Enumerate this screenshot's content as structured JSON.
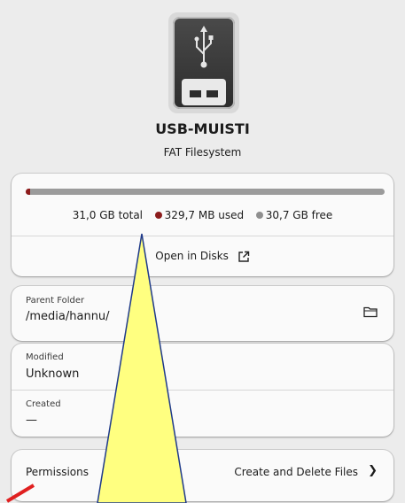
{
  "header": {
    "device_icon": "usb-drive-icon",
    "title": "USB-MUISTI",
    "subtitle": "FAT Filesystem"
  },
  "usage": {
    "total": "31,0 GB total",
    "used": "329,7 MB used",
    "free": "30,7 GB free",
    "used_fraction": 0.0106,
    "used_color": "#8e1b1b",
    "free_color": "#9b9b9b",
    "open_in_disks": "Open in Disks",
    "open_icon": "external-link-icon"
  },
  "parent": {
    "label": "Parent Folder",
    "value": "/media/hannu/",
    "icon": "folder-icon"
  },
  "dates": {
    "modified_label": "Modified",
    "modified_value": "Unknown",
    "created_label": "Created",
    "created_value": "—"
  },
  "permissions": {
    "label": "Permissions",
    "value": "Create and Delete Files",
    "icon": "chevron-right-icon"
  },
  "annotation": {
    "fill_color": "#ffff80",
    "stroke_color": "#1f3a8a",
    "mark_color": "#e02020"
  }
}
